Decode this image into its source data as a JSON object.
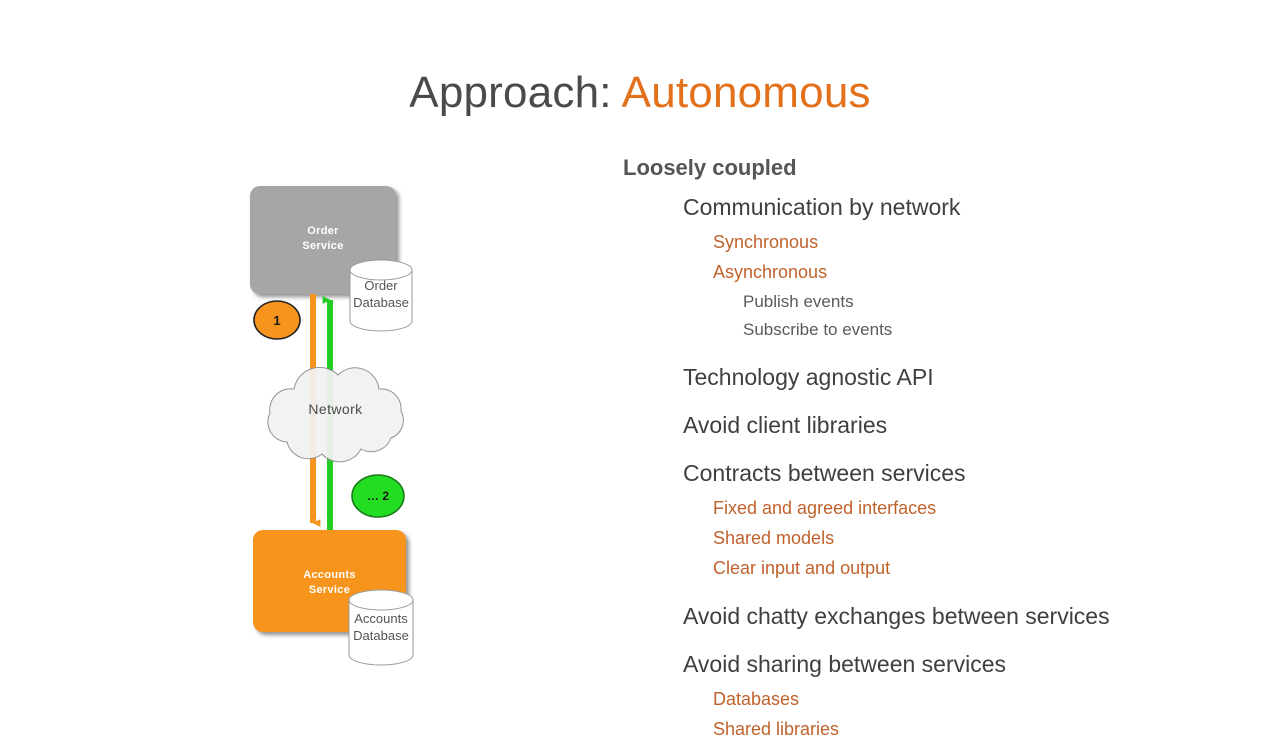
{
  "title": {
    "prefix": "Approach: ",
    "accent": "Autonomous"
  },
  "colors": {
    "title_accent": "#E3701A",
    "title_text": "#4a4a4a",
    "body_text": "#404040",
    "sub_accent": "#C0622C",
    "order_service_fill": "#A6A6A6",
    "accounts_service_fill": "#F7941E",
    "database_fill": "#FFFFFF",
    "badge_one_fill": "#F7941E",
    "badge_two_fill": "#22DD22",
    "arrow_request": "#F7941E",
    "arrow_response": "#22CC22",
    "cloud_fill": "#F2F2F2"
  },
  "bullets": [
    {
      "level": 0,
      "text": "Loosely coupled"
    },
    {
      "level": 1,
      "text": "Communication by network"
    },
    {
      "level": 2,
      "text": "Synchronous"
    },
    {
      "level": 2,
      "text": "Asynchronous"
    },
    {
      "level": 3,
      "text": "Publish events"
    },
    {
      "level": 3,
      "text": "Subscribe to events"
    },
    {
      "level": 1,
      "text": "Technology agnostic API"
    },
    {
      "level": 1,
      "text": "Avoid client libraries"
    },
    {
      "level": 1,
      "text": "Contracts between services"
    },
    {
      "level": 2,
      "text": "Fixed and agreed interfaces"
    },
    {
      "level": 2,
      "text": "Shared models"
    },
    {
      "level": 2,
      "text": "Clear input and output"
    },
    {
      "level": 1,
      "text": "Avoid chatty exchanges between services"
    },
    {
      "level": 1,
      "text": "Avoid sharing between services"
    },
    {
      "level": 2,
      "text": "Databases"
    },
    {
      "level": 2,
      "text": "Shared libraries"
    }
  ],
  "diagram": {
    "order_service": {
      "line1": "Order",
      "line2": "Service"
    },
    "order_database": {
      "line1": "Order",
      "line2": "Database"
    },
    "network_cloud": {
      "label": "Network"
    },
    "accounts_service": {
      "line1": "Accounts",
      "line2": "Service"
    },
    "accounts_database": {
      "line1": "Accounts",
      "line2": "Database"
    },
    "badge_one": {
      "label": "1"
    },
    "badge_two": {
      "label": "… 2"
    }
  }
}
